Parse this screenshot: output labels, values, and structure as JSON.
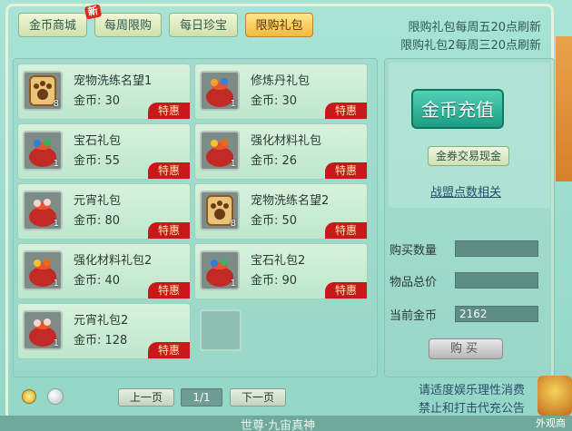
{
  "tabs": [
    {
      "label": "金币商城",
      "active": false
    },
    {
      "label": "每周限购",
      "active": false
    },
    {
      "label": "每日珍宝",
      "active": false
    },
    {
      "label": "限购礼包",
      "active": true
    }
  ],
  "new_badge": "新",
  "notices": [
    "限购礼包每周五20点刷新",
    "限购礼包2每周三20点刷新"
  ],
  "items": [
    {
      "name": "宠物洗练名望1",
      "price": "金币:  30",
      "count": "8",
      "tag": "特惠",
      "icon": "paw-badge-icon"
    },
    {
      "name": "修炼丹礼包",
      "price": "金币:  30",
      "count": "1",
      "tag": "特惠",
      "icon": "gift-bag-icon"
    },
    {
      "name": "宝石礼包",
      "price": "金币:  55",
      "count": "1",
      "tag": "特惠",
      "icon": "gift-bag-icon"
    },
    {
      "name": "强化材料礼包",
      "price": "金币:  26",
      "count": "1",
      "tag": "特惠",
      "icon": "gift-bag-icon"
    },
    {
      "name": "元宵礼包",
      "price": "金币:  80",
      "count": "1",
      "tag": "特惠",
      "icon": "gift-bag-icon"
    },
    {
      "name": "宠物洗练名望2",
      "price": "金币:  50",
      "count": "8",
      "tag": "特惠",
      "icon": "paw-badge-icon"
    },
    {
      "name": "强化材料礼包2",
      "price": "金币:  40",
      "count": "1",
      "tag": "特惠",
      "icon": "gift-bag-icon"
    },
    {
      "name": "宝石礼包2",
      "price": "金币:  90",
      "count": "1",
      "tag": "特惠",
      "icon": "gift-bag-icon"
    },
    {
      "name": "元宵礼包2",
      "price": "金币:  128",
      "count": "1",
      "tag": "特惠",
      "icon": "gift-bag-icon"
    }
  ],
  "right": {
    "recharge_label": "金币充值",
    "exchange_label": "金券交易现金",
    "alliance_link": "战盟点数相关",
    "qty_label": "购买数量",
    "qty_value": "",
    "total_label": "物品总价",
    "total_value": "",
    "current_label": "当前金币",
    "current_value": "2162",
    "buy_label": "购买"
  },
  "pager": {
    "prev": "上一页",
    "indicator": "1/1",
    "next": "下一页"
  },
  "footer": {
    "line1": "请适度娱乐理性消费",
    "line2": "禁止和打击代充公告"
  },
  "bottom_text": "世尊·九宙真神",
  "corner_label": "外观商",
  "colors": {
    "accent": "#1c9d83",
    "tag_red": "#c9181b",
    "tab_active": "#f0b93f"
  }
}
